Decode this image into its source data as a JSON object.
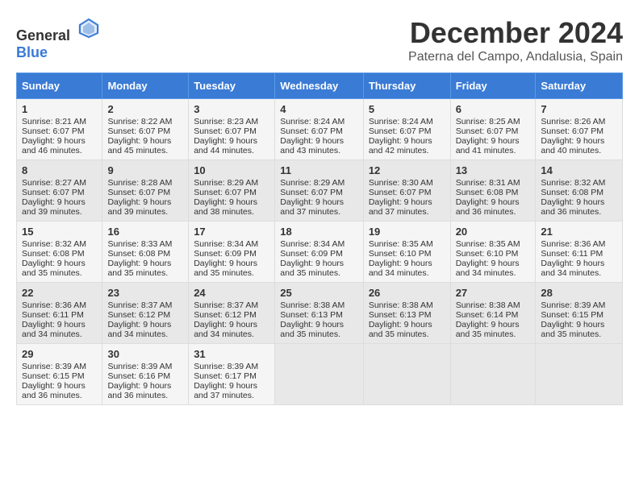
{
  "logo": {
    "text_general": "General",
    "text_blue": "Blue"
  },
  "title": {
    "month": "December 2024",
    "location": "Paterna del Campo, Andalusia, Spain"
  },
  "weekdays": [
    "Sunday",
    "Monday",
    "Tuesday",
    "Wednesday",
    "Thursday",
    "Friday",
    "Saturday"
  ],
  "weeks": [
    [
      {
        "day": "1",
        "sunrise": "Sunrise: 8:21 AM",
        "sunset": "Sunset: 6:07 PM",
        "daylight": "Daylight: 9 hours and 46 minutes."
      },
      {
        "day": "2",
        "sunrise": "Sunrise: 8:22 AM",
        "sunset": "Sunset: 6:07 PM",
        "daylight": "Daylight: 9 hours and 45 minutes."
      },
      {
        "day": "3",
        "sunrise": "Sunrise: 8:23 AM",
        "sunset": "Sunset: 6:07 PM",
        "daylight": "Daylight: 9 hours and 44 minutes."
      },
      {
        "day": "4",
        "sunrise": "Sunrise: 8:24 AM",
        "sunset": "Sunset: 6:07 PM",
        "daylight": "Daylight: 9 hours and 43 minutes."
      },
      {
        "day": "5",
        "sunrise": "Sunrise: 8:24 AM",
        "sunset": "Sunset: 6:07 PM",
        "daylight": "Daylight: 9 hours and 42 minutes."
      },
      {
        "day": "6",
        "sunrise": "Sunrise: 8:25 AM",
        "sunset": "Sunset: 6:07 PM",
        "daylight": "Daylight: 9 hours and 41 minutes."
      },
      {
        "day": "7",
        "sunrise": "Sunrise: 8:26 AM",
        "sunset": "Sunset: 6:07 PM",
        "daylight": "Daylight: 9 hours and 40 minutes."
      }
    ],
    [
      {
        "day": "8",
        "sunrise": "Sunrise: 8:27 AM",
        "sunset": "Sunset: 6:07 PM",
        "daylight": "Daylight: 9 hours and 39 minutes."
      },
      {
        "day": "9",
        "sunrise": "Sunrise: 8:28 AM",
        "sunset": "Sunset: 6:07 PM",
        "daylight": "Daylight: 9 hours and 39 minutes."
      },
      {
        "day": "10",
        "sunrise": "Sunrise: 8:29 AM",
        "sunset": "Sunset: 6:07 PM",
        "daylight": "Daylight: 9 hours and 38 minutes."
      },
      {
        "day": "11",
        "sunrise": "Sunrise: 8:29 AM",
        "sunset": "Sunset: 6:07 PM",
        "daylight": "Daylight: 9 hours and 37 minutes."
      },
      {
        "day": "12",
        "sunrise": "Sunrise: 8:30 AM",
        "sunset": "Sunset: 6:07 PM",
        "daylight": "Daylight: 9 hours and 37 minutes."
      },
      {
        "day": "13",
        "sunrise": "Sunrise: 8:31 AM",
        "sunset": "Sunset: 6:08 PM",
        "daylight": "Daylight: 9 hours and 36 minutes."
      },
      {
        "day": "14",
        "sunrise": "Sunrise: 8:32 AM",
        "sunset": "Sunset: 6:08 PM",
        "daylight": "Daylight: 9 hours and 36 minutes."
      }
    ],
    [
      {
        "day": "15",
        "sunrise": "Sunrise: 8:32 AM",
        "sunset": "Sunset: 6:08 PM",
        "daylight": "Daylight: 9 hours and 35 minutes."
      },
      {
        "day": "16",
        "sunrise": "Sunrise: 8:33 AM",
        "sunset": "Sunset: 6:08 PM",
        "daylight": "Daylight: 9 hours and 35 minutes."
      },
      {
        "day": "17",
        "sunrise": "Sunrise: 8:34 AM",
        "sunset": "Sunset: 6:09 PM",
        "daylight": "Daylight: 9 hours and 35 minutes."
      },
      {
        "day": "18",
        "sunrise": "Sunrise: 8:34 AM",
        "sunset": "Sunset: 6:09 PM",
        "daylight": "Daylight: 9 hours and 35 minutes."
      },
      {
        "day": "19",
        "sunrise": "Sunrise: 8:35 AM",
        "sunset": "Sunset: 6:10 PM",
        "daylight": "Daylight: 9 hours and 34 minutes."
      },
      {
        "day": "20",
        "sunrise": "Sunrise: 8:35 AM",
        "sunset": "Sunset: 6:10 PM",
        "daylight": "Daylight: 9 hours and 34 minutes."
      },
      {
        "day": "21",
        "sunrise": "Sunrise: 8:36 AM",
        "sunset": "Sunset: 6:11 PM",
        "daylight": "Daylight: 9 hours and 34 minutes."
      }
    ],
    [
      {
        "day": "22",
        "sunrise": "Sunrise: 8:36 AM",
        "sunset": "Sunset: 6:11 PM",
        "daylight": "Daylight: 9 hours and 34 minutes."
      },
      {
        "day": "23",
        "sunrise": "Sunrise: 8:37 AM",
        "sunset": "Sunset: 6:12 PM",
        "daylight": "Daylight: 9 hours and 34 minutes."
      },
      {
        "day": "24",
        "sunrise": "Sunrise: 8:37 AM",
        "sunset": "Sunset: 6:12 PM",
        "daylight": "Daylight: 9 hours and 34 minutes."
      },
      {
        "day": "25",
        "sunrise": "Sunrise: 8:38 AM",
        "sunset": "Sunset: 6:13 PM",
        "daylight": "Daylight: 9 hours and 35 minutes."
      },
      {
        "day": "26",
        "sunrise": "Sunrise: 8:38 AM",
        "sunset": "Sunset: 6:13 PM",
        "daylight": "Daylight: 9 hours and 35 minutes."
      },
      {
        "day": "27",
        "sunrise": "Sunrise: 8:38 AM",
        "sunset": "Sunset: 6:14 PM",
        "daylight": "Daylight: 9 hours and 35 minutes."
      },
      {
        "day": "28",
        "sunrise": "Sunrise: 8:39 AM",
        "sunset": "Sunset: 6:15 PM",
        "daylight": "Daylight: 9 hours and 35 minutes."
      }
    ],
    [
      {
        "day": "29",
        "sunrise": "Sunrise: 8:39 AM",
        "sunset": "Sunset: 6:15 PM",
        "daylight": "Daylight: 9 hours and 36 minutes."
      },
      {
        "day": "30",
        "sunrise": "Sunrise: 8:39 AM",
        "sunset": "Sunset: 6:16 PM",
        "daylight": "Daylight: 9 hours and 36 minutes."
      },
      {
        "day": "31",
        "sunrise": "Sunrise: 8:39 AM",
        "sunset": "Sunset: 6:17 PM",
        "daylight": "Daylight: 9 hours and 37 minutes."
      },
      null,
      null,
      null,
      null
    ]
  ]
}
